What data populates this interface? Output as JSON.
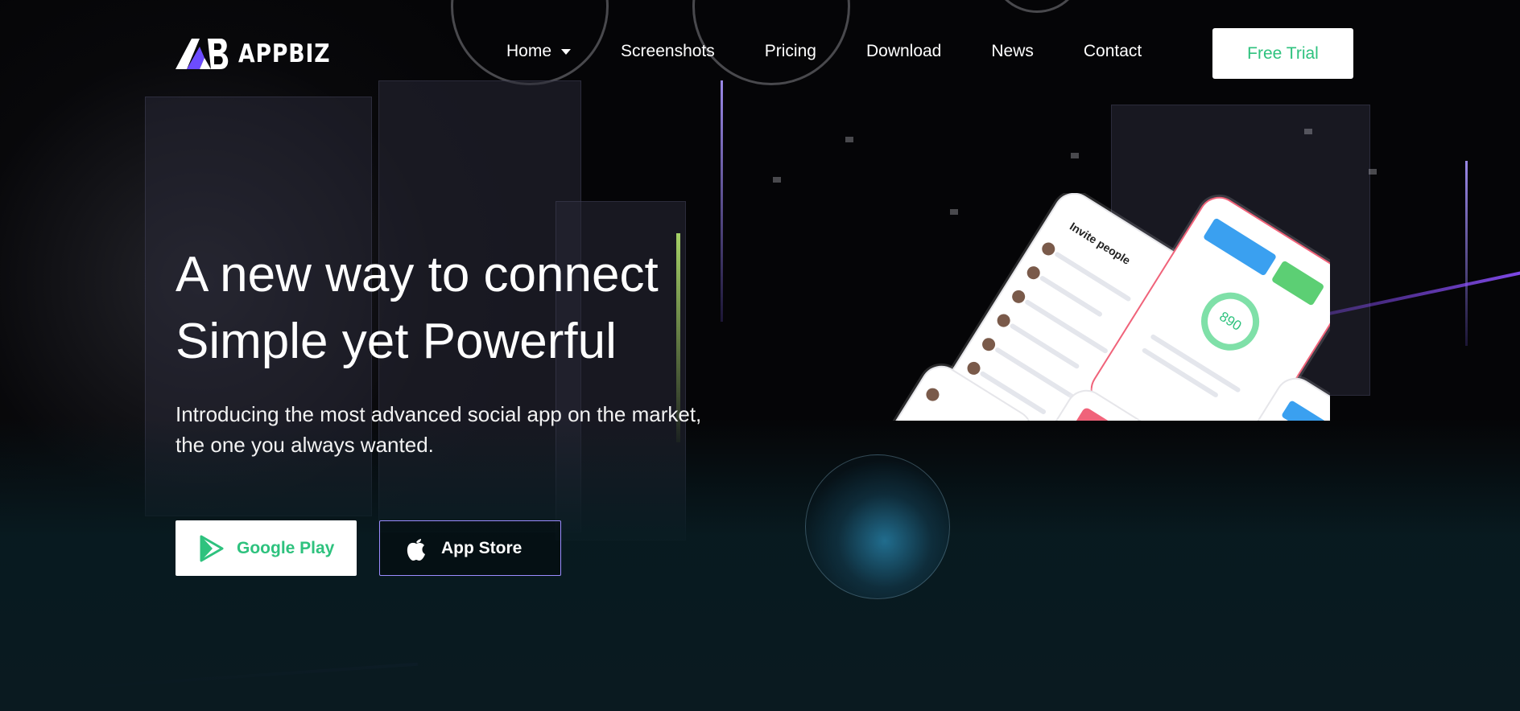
{
  "brand": {
    "name": "APPBIZ",
    "mark": "AB"
  },
  "nav": {
    "items": [
      {
        "label": "Home"
      },
      {
        "label": "Screenshots"
      },
      {
        "label": "Pricing"
      },
      {
        "label": "Download"
      },
      {
        "label": "News"
      },
      {
        "label": "Contact"
      }
    ],
    "cta_label": "Free Trial"
  },
  "hero": {
    "title_line1": "A new way to connect",
    "title_line2": "Simple yet Powerful",
    "intro": "Introducing the most advanced social app on the market, the one you always wanted.",
    "buttons": {
      "google_play": "Google Play",
      "app_store": "App Store"
    }
  },
  "mockup": {
    "screen1_title": "Invite people",
    "gauge_value": "890"
  },
  "colors": {
    "accent_green": "#2ec27e",
    "app_store_border": "#9b8cff",
    "logo_accent": "#6c4cff"
  }
}
